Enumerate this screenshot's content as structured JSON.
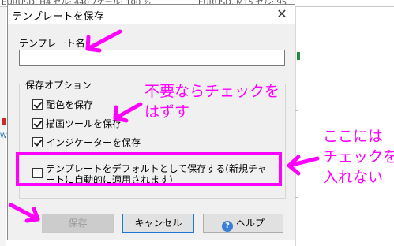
{
  "background": {
    "left_chart_title": "EURUSD, H4  セル: 440  7ケール: 100 %",
    "right_chart_title": "EURUSD, M15  セル: 95",
    "side_label": "W"
  },
  "dialog": {
    "title": "テンプレートを保存",
    "close_symbol": "✕",
    "name_label": "テンプレート名:",
    "name_value": "",
    "options_legend": "保存オプション",
    "options": [
      {
        "label": "配色を保存",
        "checked": true
      },
      {
        "label": "描画ツールを保存",
        "checked": true
      },
      {
        "label": "インジケーターを保存",
        "checked": true
      },
      {
        "label": "テンプレートをデフォルトとして保存する(新規チャートに自動的に適用されます)",
        "checked": false
      }
    ],
    "buttons": {
      "save": "保存",
      "cancel": "キャンセル",
      "help": "ヘルプ",
      "help_icon_glyph": "?"
    }
  },
  "annotations": {
    "note1_line1": "不要ならチェックを",
    "note1_line2": "はずす",
    "note2_line1": "ここには",
    "note2_line2": "チェックを",
    "note2_line3": "入れない",
    "color": "#ff00ff"
  }
}
